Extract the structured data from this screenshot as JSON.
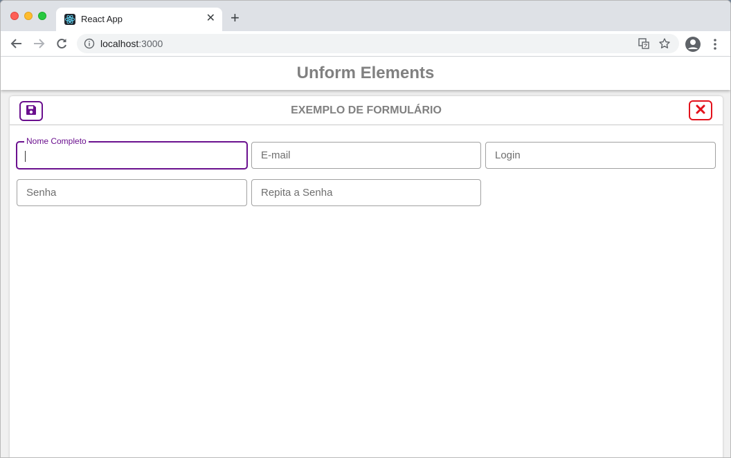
{
  "browser": {
    "tab_title": "React App",
    "tab_close": "✕",
    "new_tab": "+",
    "url_host": "localhost",
    "url_port": ":3000"
  },
  "page": {
    "title": "Unform Elements"
  },
  "form": {
    "title": "EXEMPLO DE FORMULÁRIO",
    "fields": [
      {
        "label": "Nome Completo",
        "value": "",
        "placeholder": ""
      },
      {
        "placeholder": "E-mail",
        "value": ""
      },
      {
        "placeholder": "Login",
        "value": ""
      },
      {
        "placeholder": "Senha",
        "value": ""
      },
      {
        "placeholder": "Repita a Senha",
        "value": ""
      }
    ]
  },
  "colors": {
    "accent": "#6a0f8e",
    "danger": "#e3111b",
    "heading": "#808080"
  }
}
